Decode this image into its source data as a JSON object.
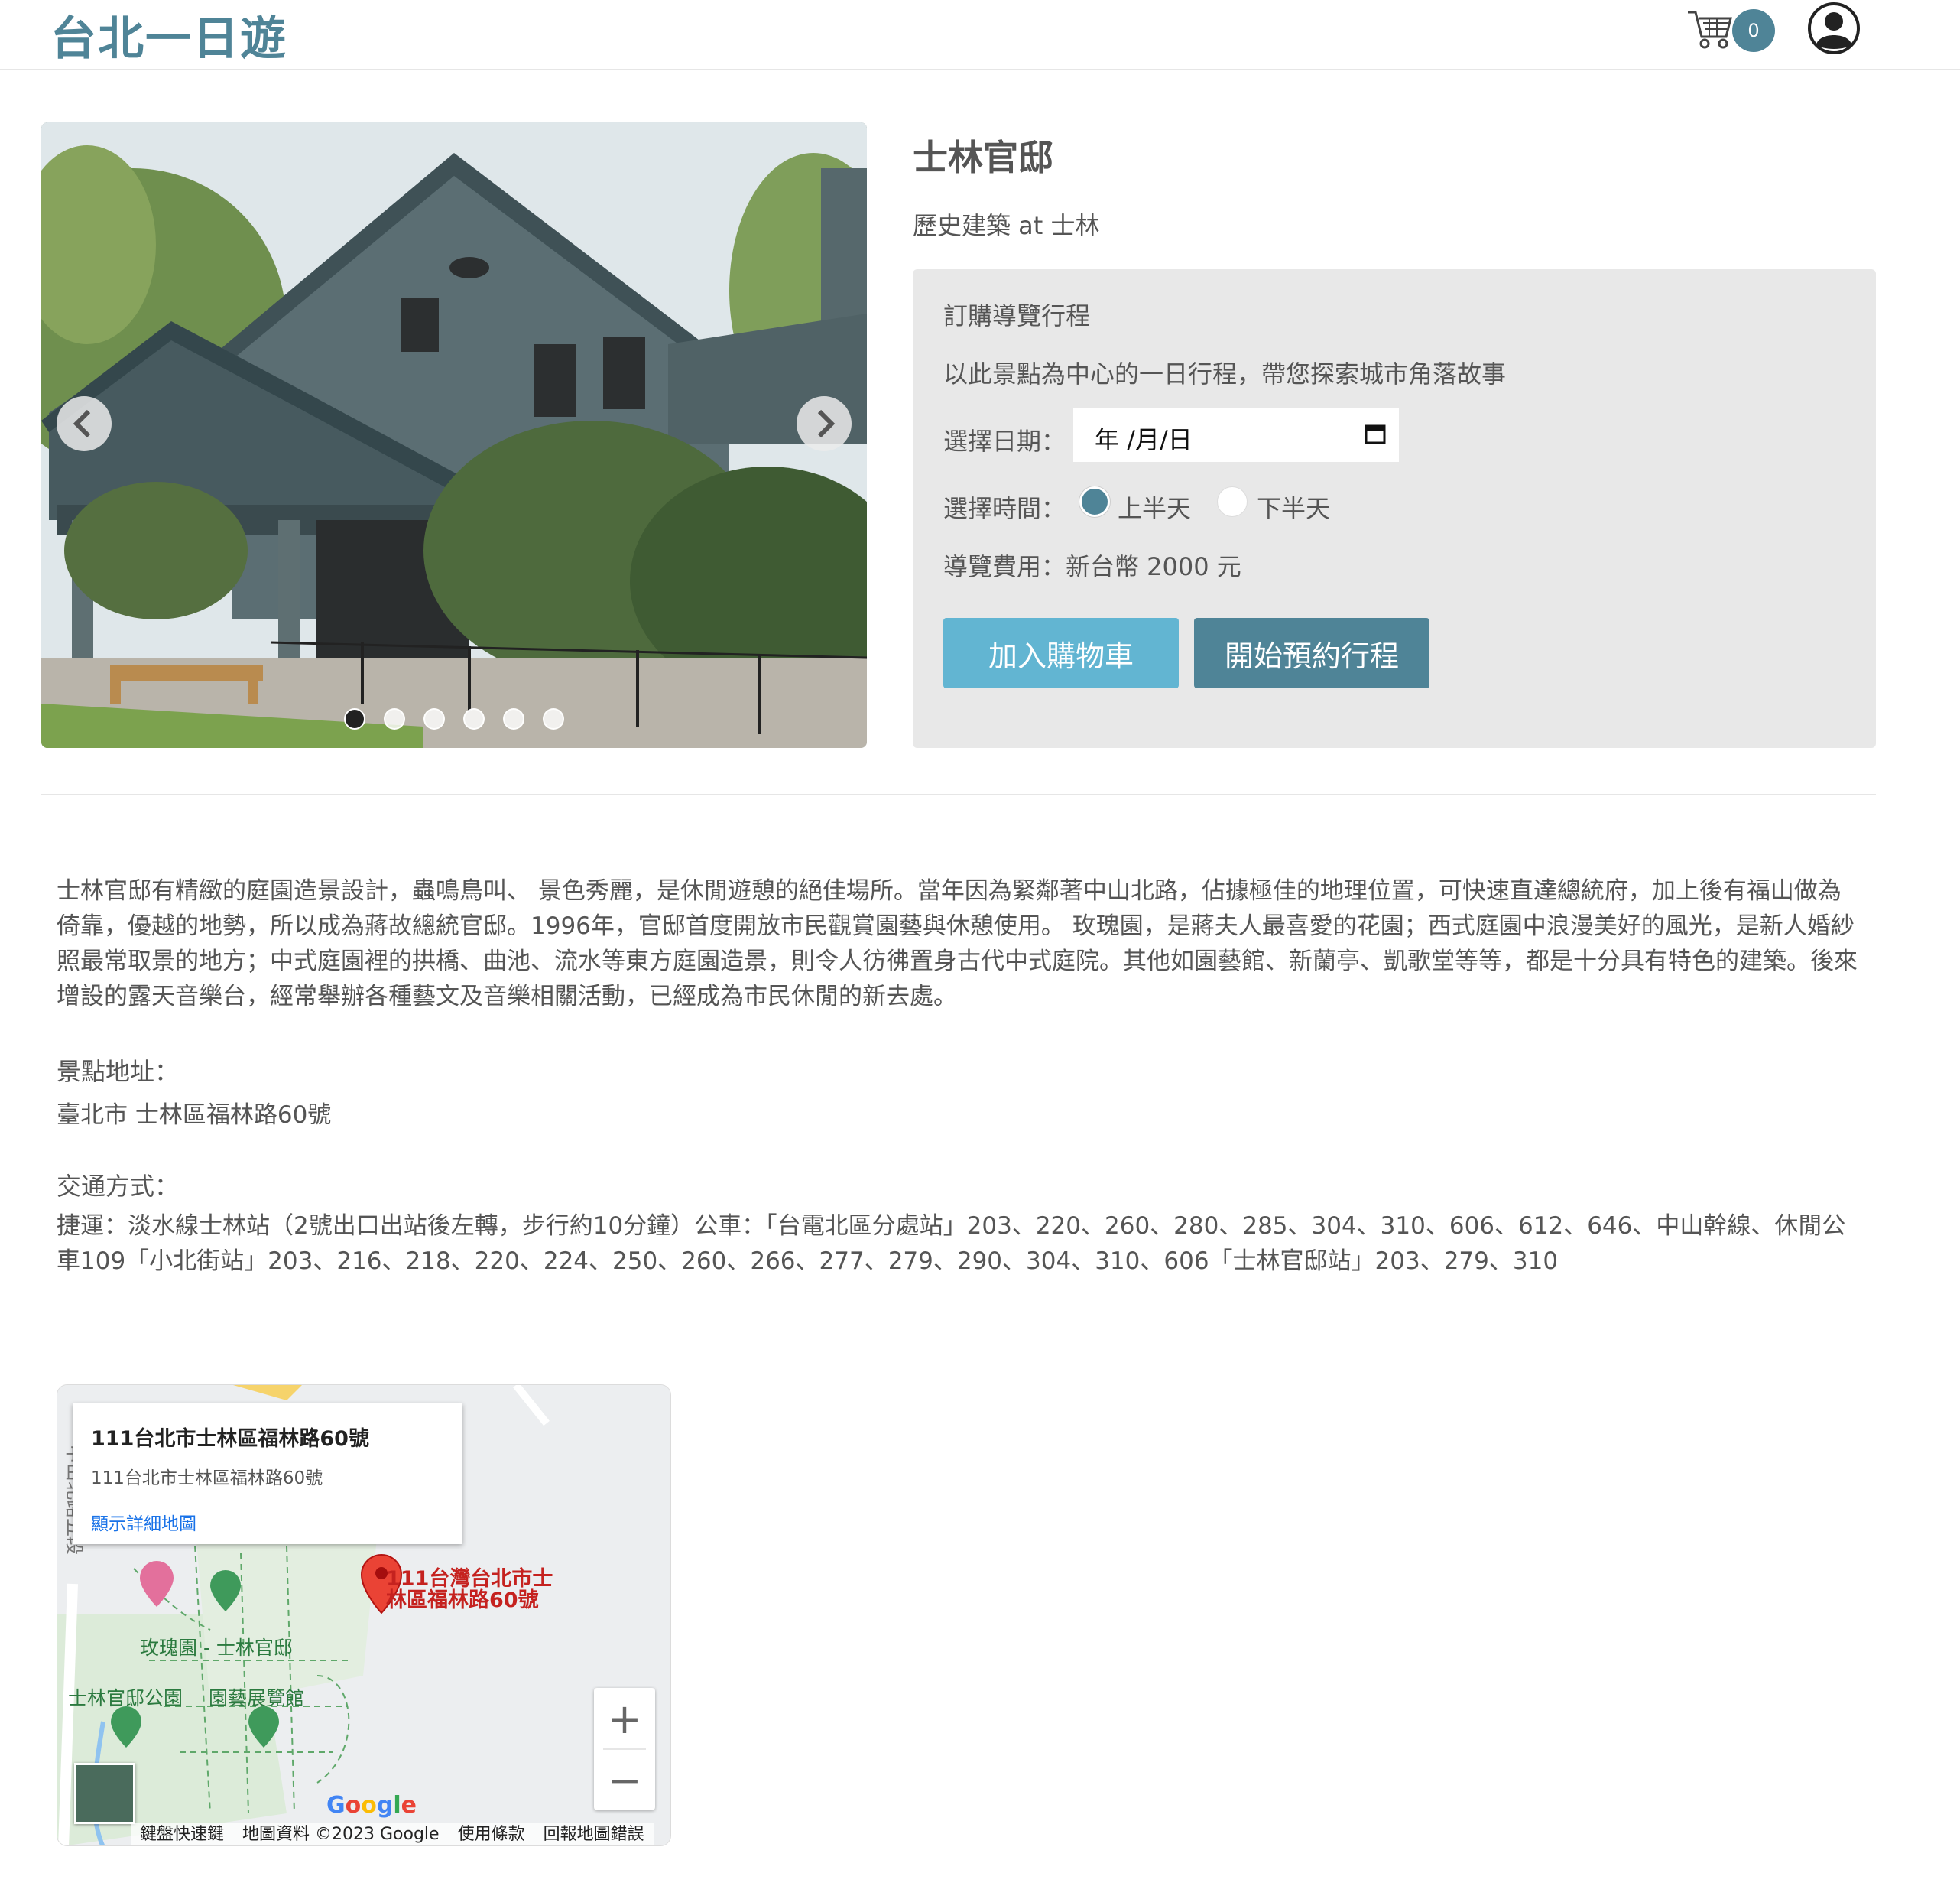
{
  "header": {
    "brand": "台北一日遊",
    "cart_count": "0"
  },
  "carousel": {
    "slide_count": 6,
    "active_index": 0
  },
  "attraction": {
    "name": "士林官邸",
    "category_line": "歷史建築 at 士林"
  },
  "booking": {
    "title": "訂購導覽行程",
    "description": "以此景點為中心的一日行程，帶您探索城市角落故事",
    "date_label": "選擇日期：",
    "date_placeholder": "年 /月/日",
    "time_label": "選擇時間：",
    "time_options": [
      "上半天",
      "下半天"
    ],
    "time_selected": "上半天",
    "fee_text": "導覽費用：新台幣 2000 元",
    "add_to_cart": "加入購物車",
    "start_booking": "開始預約行程"
  },
  "details": {
    "description": "士林官邸有精緻的庭園造景設計，蟲鳴鳥叫、 景色秀麗，是休閒遊憩的絕佳場所。當年因為緊鄰著中山北路，佔據極佳的地理位置，可快速直達總統府，加上後有福山做為倚靠，優越的地勢，所以成為蔣故總統官邸。1996年，官邸首度開放市民觀賞園藝與休憩使用。 玫瑰園，是蔣夫人最喜愛的花園；西式庭園中浪漫美好的風光，是新人婚紗照最常取景的地方；中式庭園裡的拱橋、曲池、流水等東方庭園造景，則令人彷彿置身古代中式庭院。其他如園藝館、新蘭亭、凱歌堂等等，都是十分具有特色的建築。後來增設的露天音樂台，經常舉辦各種藝文及音樂相關活動，已經成為市民休閒的新去處。",
    "address_label": "景點地址：",
    "address": "臺北市 士林區福林路60號",
    "transport_label": "交通方式：",
    "transport": "捷運：淡水線士林站（2號出口出站後左轉，步行約10分鐘）公車：「台電北區分處站」203、220、260、280、285、304、310、606、612、646、中山幹線、休閒公車109「小北街站」203、216、218、220、224、250、260、266、277、279、290、304、310、606「士林官邸站」203、279、310"
  },
  "map": {
    "info_title": "111台北市士林區福林路60號",
    "info_sub": "111台北市士林區福林路60號",
    "info_link": "顯示詳細地圖",
    "pin_label": "111台灣台北市士林區福林路60號",
    "poi_rose": "玫瑰園 - 士林官邸",
    "poi_park": "士林官邸公園",
    "poi_garden": "園藝展覽館",
    "road_label": "中山北路五段",
    "zoom_in": "+",
    "zoom_out": "−",
    "google": "Google",
    "footer": [
      "鍵盤快速鍵",
      "地圖資料 ©2023 Google",
      "使用條款",
      "回報地圖錯誤"
    ]
  },
  "colors": {
    "brand": "#4f8497",
    "add_button": "#62b5d2",
    "booking_bg": "#e8e8e8"
  }
}
